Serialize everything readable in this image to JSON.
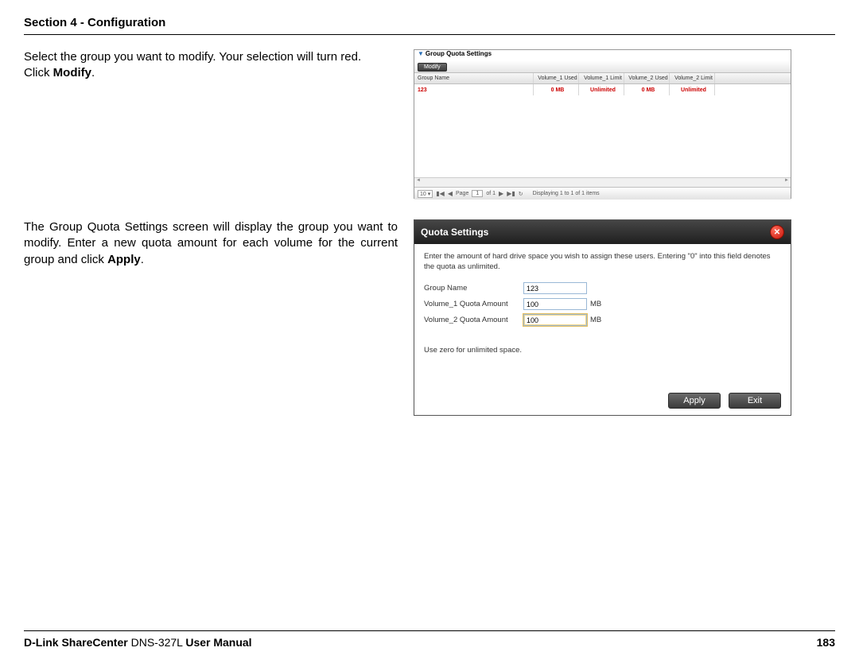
{
  "header": {
    "section": "Section 4 - Configuration"
  },
  "block1": {
    "desc_line1": "Select the group you want to modify. Your selection will turn red.",
    "desc_line2_pre": "Click ",
    "desc_line2_bold": "Modify",
    "desc_line2_post": "."
  },
  "grid": {
    "title": "Group Quota Settings",
    "modify_label": "Modify",
    "columns": [
      "Group Name",
      "Volume_1 Used",
      "Volume_1 Limit",
      "Volume_2 Used",
      "Volume_2 Limit"
    ],
    "row": {
      "name": "123",
      "v1u": "0 MB",
      "v1l": "Unlimited",
      "v2u": "0 MB",
      "v2l": "Unlimited"
    },
    "pager": {
      "page_size": "10",
      "page_label": "Page",
      "page_value": "1",
      "of_label": "of 1",
      "info": "Displaying 1 to 1 of 1 items"
    }
  },
  "block2": {
    "desc": "The Group Quota Settings screen will display the group you want to modify. Enter a new quota amount for each volume for the current group and click ",
    "desc_bold": "Apply",
    "desc_post": "."
  },
  "dialog": {
    "title": "Quota Settings",
    "instr": "Enter the amount of hard drive space you wish to assign these users. Entering \"0\" into this field denotes the quota as unlimited.",
    "group_label": "Group Name",
    "group_value": "123",
    "v1_label": "Volume_1 Quota Amount",
    "v1_value": "100",
    "v2_label": "Volume_2 Quota Amount",
    "v2_value": "100",
    "unit": "MB",
    "note": "Use zero for unlimited space.",
    "apply": "Apply",
    "exit": "Exit"
  },
  "footer": {
    "brand": "D-Link ShareCenter",
    "model": " DNS-327L ",
    "suffix": "User Manual",
    "page": "183"
  }
}
